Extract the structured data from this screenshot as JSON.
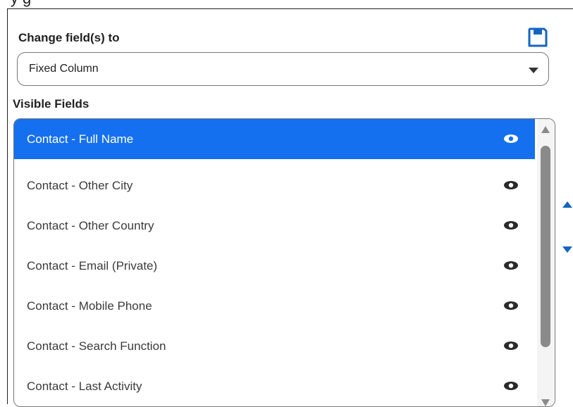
{
  "top_clipped_text": "~y g",
  "change_fields": {
    "label": "Change field(s) to",
    "selected_value": "Fixed Column"
  },
  "visible_fields": {
    "label": "Visible Fields",
    "items": [
      {
        "label": "Contact - Full Name",
        "selected": true
      },
      {
        "label": "Contact - Other City",
        "selected": false
      },
      {
        "label": "Contact - Other Country",
        "selected": false
      },
      {
        "label": "Contact - Email (Private)",
        "selected": false
      },
      {
        "label": "Contact - Mobile Phone",
        "selected": false
      },
      {
        "label": "Contact - Search Function",
        "selected": false
      },
      {
        "label": "Contact - Last Activity",
        "selected": false
      }
    ]
  },
  "colors": {
    "accent": "#1570ef",
    "arrow": "#1565c0"
  },
  "icons": {
    "save": "save-icon",
    "visibility": "eye-icon",
    "move_up": "caret-up-icon",
    "move_down": "caret-down-icon"
  }
}
